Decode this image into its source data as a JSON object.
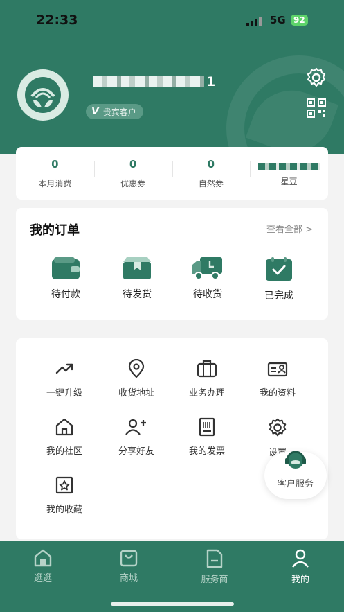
{
  "status": {
    "time": "22:33",
    "network": "5G",
    "battery": "92"
  },
  "profile": {
    "name_suffix": "1",
    "level": "贵宾客户",
    "level_mark": "V"
  },
  "stats": [
    {
      "value": "0",
      "label": "本月消费"
    },
    {
      "value": "0",
      "label": "优惠券"
    },
    {
      "value": "0",
      "label": "自然券"
    },
    {
      "value": "",
      "label": "星豆"
    }
  ],
  "orders": {
    "title": "我的订单",
    "view_all": "查看全部 >",
    "items": [
      {
        "label": "待付款",
        "icon": "wallet-icon"
      },
      {
        "label": "待发货",
        "icon": "box-icon"
      },
      {
        "label": "待收货",
        "icon": "truck-icon"
      },
      {
        "label": "已完成",
        "icon": "done-icon"
      }
    ]
  },
  "services": [
    {
      "label": "一键升级",
      "icon": "trend-up-icon"
    },
    {
      "label": "收货地址",
      "icon": "location-icon"
    },
    {
      "label": "业务办理",
      "icon": "briefcase-icon"
    },
    {
      "label": "我的资料",
      "icon": "id-card-icon"
    },
    {
      "label": "我的社区",
      "icon": "community-icon"
    },
    {
      "label": "分享好友",
      "icon": "add-friend-icon"
    },
    {
      "label": "我的发票",
      "icon": "invoice-icon"
    },
    {
      "label": "设置",
      "icon": "settings-icon"
    },
    {
      "label": "我的收藏",
      "icon": "favorite-icon"
    }
  ],
  "customer_service": {
    "label": "客户服务"
  },
  "tabs": [
    {
      "label": "逛逛",
      "icon": "home-icon"
    },
    {
      "label": "商城",
      "icon": "shopping-bag-icon"
    },
    {
      "label": "服务商",
      "icon": "document-icon"
    },
    {
      "label": "我的",
      "icon": "user-icon",
      "active": true
    }
  ],
  "colors": {
    "primary": "#2f7a64",
    "background": "#f3f3f3"
  }
}
